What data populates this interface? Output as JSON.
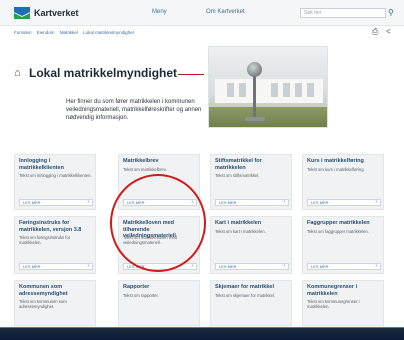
{
  "header": {
    "logo_text": "Kartverket",
    "nav": [
      {
        "label": "Meny"
      },
      {
        "label": "Om Kartverket"
      }
    ],
    "search_placeholder": "Søk her",
    "icons": {
      "search": "search-icon",
      "print": "print-icon",
      "share": "share-icon"
    }
  },
  "breadcrumb": [
    "Forsiden",
    "Eiendom",
    "Matrikkel",
    "Lokal matrikkelmyndighet"
  ],
  "hero": {
    "title": "Lokal matrikkelmyndighet",
    "text": "Her finner du som fører matrikkelen i kommunen veiledningsmateriell, matrikkelføreskrifter og annen nødvendig informasjon."
  },
  "read_more_label": "LES MER",
  "cards": [
    {
      "title": "Innlogging i matrikkelklienten",
      "body": "Tekst om innlogging i matrikkelklienten."
    },
    {
      "title": "Matrikkelbrev",
      "body": "Tekst om matrikkelbrev."
    },
    {
      "title": "Stiftsmatrikkel for matrikkelen",
      "body": "Tekst om stiftsmatrikkel."
    },
    {
      "title": "Kurs i matrikkelføring",
      "body": "Tekst om kurs i matrikkelføring."
    },
    {
      "title": "Føringsinstruks for matrikkelen, versjon 3.8",
      "body": "Tekst om føringsinstruks for matrikkelen."
    },
    {
      "title": "Matrikkelloven med tilhørende veiledningsmateriell",
      "body": "Tekst om matrikkelloven med veiledningsmateriell."
    },
    {
      "title": "Kart i matrikkelen",
      "body": "Tekst om kart i matrikkelen."
    },
    {
      "title": "Faggrupper matrikkelen",
      "body": "Tekst om faggrupper matrikkelen."
    },
    {
      "title": "Kommunen som adressemyndighet",
      "body": "Tekst om kommunen som adressemyndighet."
    },
    {
      "title": "Rapporter",
      "body": "Tekst om rapporter."
    },
    {
      "title": "Skjemaer for matrikkel",
      "body": "Tekst om skjemaer for matrikkel."
    },
    {
      "title": "Kommunegrenser i matrikkelen",
      "body": "Tekst om kommunegrenser i matrikkelen."
    }
  ],
  "colors": {
    "accent_red": "#b5151b",
    "link_blue": "#3f6f9d",
    "annotation_red": "#d11a1a"
  }
}
